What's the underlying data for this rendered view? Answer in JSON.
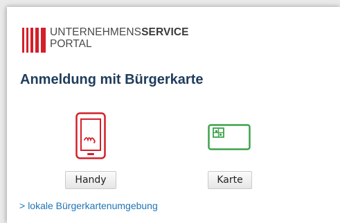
{
  "logo": {
    "line1_light": "UNTERNEHMENS",
    "line1_bold": "SERVICE",
    "line2": "PORTAL",
    "brand_color": "#d3202a"
  },
  "page": {
    "title": "Anmeldung mit Bürgerkarte"
  },
  "options": {
    "handy": {
      "icon": "mobile-phone-signature-icon",
      "color": "#d3202a",
      "button_label": "Handy"
    },
    "karte": {
      "icon": "smart-card-icon",
      "color": "#3ba34a",
      "button_label": "Karte"
    }
  },
  "footer_link": {
    "chevron": ">",
    "label": "lokale Bürgerkartenumgebung",
    "color": "#1f74b5"
  }
}
